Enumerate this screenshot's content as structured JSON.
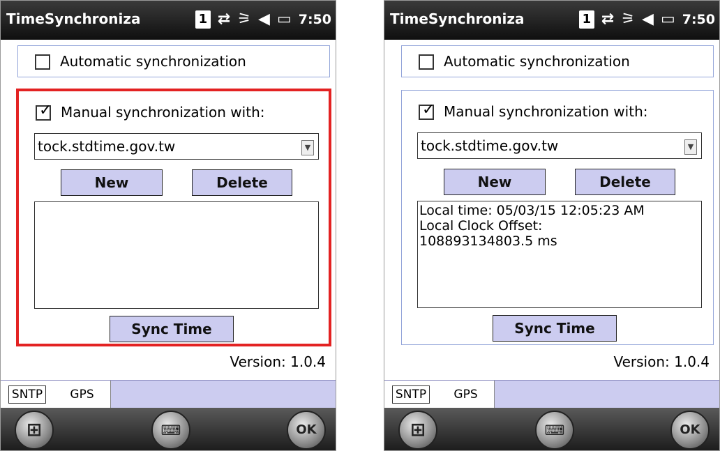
{
  "left": {
    "title": "TimeSynchroniza",
    "status": {
      "indicator": "1",
      "time": "7:50"
    },
    "auto_sync_label": "Automatic synchronization",
    "manual_sync_label": "Manual synchronization with:",
    "server": "tock.stdtime.gov.tw",
    "new_label": "New",
    "delete_label": "Delete",
    "output_lines": [],
    "sync_label": "Sync Time",
    "version": "Version: 1.0.4",
    "tabs": [
      "SNTP",
      "GPS"
    ],
    "ok_label": "OK"
  },
  "right": {
    "title": "TimeSynchroniza",
    "status": {
      "indicator": "1",
      "time": "7:50"
    },
    "auto_sync_label": "Automatic synchronization",
    "manual_sync_label": "Manual synchronization with:",
    "server": "tock.stdtime.gov.tw",
    "new_label": "New",
    "delete_label": "Delete",
    "output_lines": [
      "Local time: 05/03/15 12:05:23 AM",
      "Local Clock Offset:",
      "108893134803.5 ms"
    ],
    "sync_label": "Sync Time",
    "version": "Version: 1.0.4",
    "tabs": [
      "SNTP",
      "GPS"
    ],
    "ok_label": "OK"
  },
  "icons": {
    "status": [
      "sim-indicator-icon",
      "connectivity-icon",
      "signal-icon",
      "volume-icon",
      "battery-icon"
    ],
    "softkeys": [
      "windows-start-icon",
      "keyboard-icon",
      "ok-icon"
    ],
    "combo": "dropdown-arrow-icon"
  },
  "colors": {
    "highlight": "#e32222",
    "button": "#ccccf0",
    "group_border": "#93a5d9"
  },
  "state": {
    "auto_sync_checked": false,
    "manual_sync_checked": true,
    "left_manual_highlighted": true
  }
}
